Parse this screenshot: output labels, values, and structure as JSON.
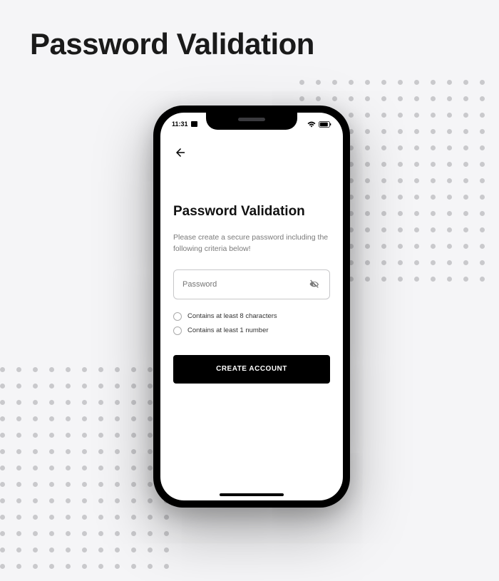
{
  "page": {
    "title": "Password Validation"
  },
  "status_bar": {
    "time": "11:31",
    "battery": "87"
  },
  "screen": {
    "title": "Password Validation",
    "subtitle": "Please create a secure password including the following criteria below!",
    "password_placeholder": "Password",
    "criteria": [
      {
        "label": "Contains at least 8 characters"
      },
      {
        "label": "Contains at least 1 number"
      }
    ],
    "submit_label": "CREATE ACCOUNT"
  },
  "icons": {
    "back": "arrow-back-icon",
    "sms": "sms-icon",
    "wifi": "wifi-icon",
    "battery": "battery-icon",
    "eye_off": "eye-off-icon"
  }
}
